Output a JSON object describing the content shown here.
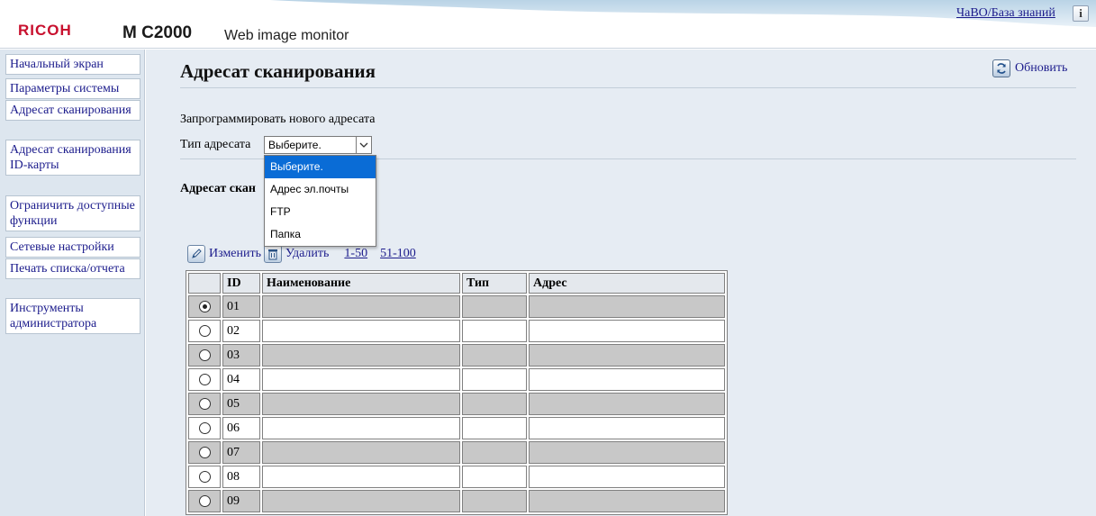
{
  "header": {
    "brand": "RICOH",
    "model": "M C2000",
    "app_name": "Web image monitor",
    "faq_link": "ЧаВО/База знаний",
    "info_button": "i"
  },
  "sidebar": {
    "items": [
      {
        "label": "Начальный экран"
      },
      {
        "label": "Параметры системы"
      },
      {
        "label": "Адресат сканирования"
      },
      {
        "label": "Адресат сканирования ID-карты"
      },
      {
        "label": "Ограничить доступные функции"
      },
      {
        "label": "Сетевые настройки"
      },
      {
        "label": "Печать списка/отчета"
      },
      {
        "label": "Инструменты администратора"
      }
    ]
  },
  "main": {
    "title": "Адресат сканирования",
    "refresh_label": "Обновить",
    "program_new": "Запрограммировать нового адресата",
    "type_label": "Тип адресата",
    "select_value": "Выберите.",
    "dropdown_options": [
      "Выберите.",
      "Адрес эл.почты",
      "FTP",
      "Папка"
    ],
    "section_title": "Адресат скан"
  },
  "toolbar": {
    "edit_label": "Изменить",
    "delete_label": "Удалить",
    "page_links": [
      "1-50",
      "51-100"
    ]
  },
  "table": {
    "columns": [
      "",
      "ID",
      "Наименование",
      "Тип",
      "Адрес"
    ],
    "selected_id": "01",
    "rows": [
      {
        "id": "01",
        "name": "",
        "type": "",
        "address": ""
      },
      {
        "id": "02",
        "name": "",
        "type": "",
        "address": ""
      },
      {
        "id": "03",
        "name": "",
        "type": "",
        "address": ""
      },
      {
        "id": "04",
        "name": "",
        "type": "",
        "address": ""
      },
      {
        "id": "05",
        "name": "",
        "type": "",
        "address": ""
      },
      {
        "id": "06",
        "name": "",
        "type": "",
        "address": ""
      },
      {
        "id": "07",
        "name": "",
        "type": "",
        "address": ""
      },
      {
        "id": "08",
        "name": "",
        "type": "",
        "address": ""
      },
      {
        "id": "09",
        "name": "",
        "type": "",
        "address": ""
      }
    ]
  },
  "colors": {
    "brand_red": "#c8102e",
    "link_blue": "#1c1c8c",
    "sidebar_bg": "#dde6ef",
    "content_bg": "#e6ecf3",
    "selection_blue": "#0a6cd6",
    "row_gray": "#c8c8c8"
  },
  "icons": {
    "refresh": "refresh-icon",
    "edit": "edit-pencil-icon",
    "delete": "trash-icon",
    "select_arrow": "chevron-down-icon"
  }
}
